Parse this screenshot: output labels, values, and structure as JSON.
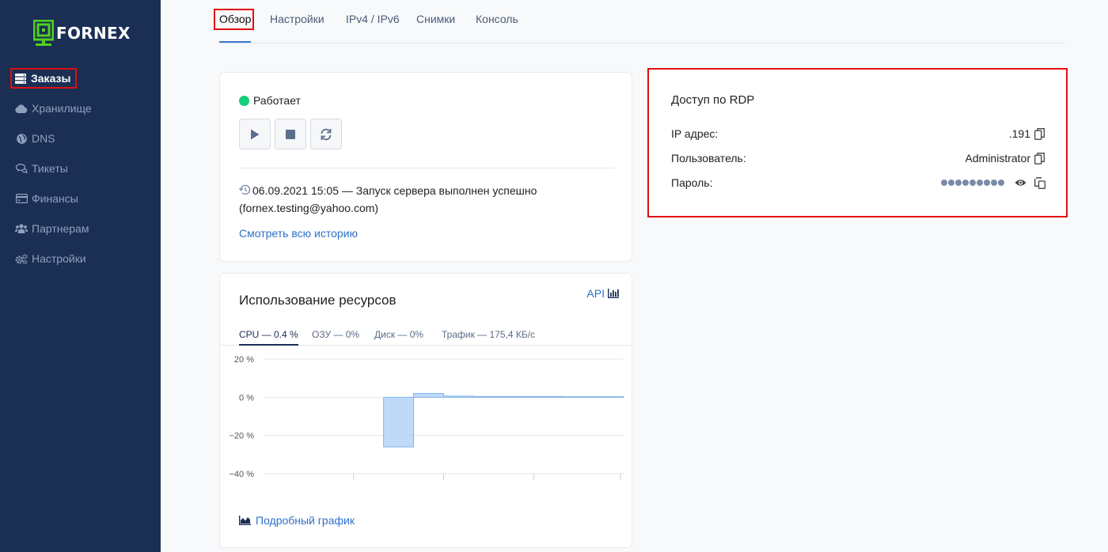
{
  "brand": {
    "name": "FORNEX",
    "color": "#4fd11d"
  },
  "sidebar": {
    "items": [
      {
        "label": "Заказы",
        "icon": "server-icon"
      },
      {
        "label": "Хранилище",
        "icon": "cloud-icon"
      },
      {
        "label": "DNS",
        "icon": "globe-icon"
      },
      {
        "label": "Тикеты",
        "icon": "comments-icon"
      },
      {
        "label": "Финансы",
        "icon": "credit-card-icon"
      },
      {
        "label": "Партнерам",
        "icon": "users-icon"
      },
      {
        "label": "Настройки",
        "icon": "cogs-icon"
      }
    ]
  },
  "tabs": [
    {
      "label": "Обзор"
    },
    {
      "label": "Настройки"
    },
    {
      "label": "IPv4 / IPv6"
    },
    {
      "label": "Снимки"
    },
    {
      "label": "Консоль"
    }
  ],
  "server": {
    "status": "Работает",
    "status_color": "#14d07a",
    "controls": [
      "play-icon",
      "stop-icon",
      "refresh-icon"
    ],
    "last_event_line1": "06.09.2021 15:05 — Запуск сервера выполнен успешно",
    "last_event_line2": "(fornex.testing@yahoo.com)",
    "history_link": "Смотреть всю историю"
  },
  "resources": {
    "title": "Использование ресурсов",
    "api_link": "API",
    "tabs": [
      {
        "label": "CPU — 0.4 %"
      },
      {
        "label": "ОЗУ — 0%"
      },
      {
        "label": "Диск — 0%"
      },
      {
        "label": "Трафик — 175,4 КБ/с"
      }
    ],
    "detail_link": "Подробный график"
  },
  "chart_data": {
    "type": "area",
    "title": "",
    "xlabel": "",
    "ylabel": "",
    "yticks": [
      "20 %",
      "0 %",
      "−20 %",
      "−40 %"
    ],
    "ylim": [
      -40,
      20
    ],
    "grid": true,
    "series": [
      {
        "color": "#a9cdf5",
        "x": [
          0,
          1,
          2,
          3,
          4,
          5,
          6,
          7,
          8,
          9,
          10,
          11,
          12
        ],
        "values": [
          null,
          null,
          null,
          null,
          -26,
          2,
          0.6,
          0.4,
          0.4,
          0.4,
          0.3,
          0.3,
          0.3
        ]
      }
    ]
  },
  "rdp": {
    "title": "Доступ по RDP",
    "ip_label": "IP адрес:",
    "ip_value": ".191",
    "user_label": "Пользователь:",
    "user_value": "Administrator",
    "password_label": "Пароль:",
    "password_dots": 9
  }
}
